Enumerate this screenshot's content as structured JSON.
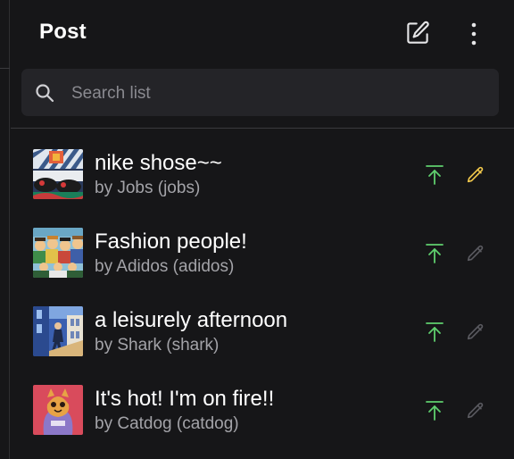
{
  "header": {
    "title": "Post",
    "compose_icon": "compose-icon",
    "more_icon": "more-vertical-icon"
  },
  "search": {
    "placeholder": "Search list",
    "value": "",
    "icon": "search-icon"
  },
  "posts": [
    {
      "title": "nike shose~~",
      "byline": "by Jobs (jobs)",
      "pin_icon": "pin-to-top-icon",
      "edit_icon": "edit-pencil-icon",
      "editable": true
    },
    {
      "title": "Fashion people!",
      "byline": "by Adidos (adidos)",
      "pin_icon": "pin-to-top-icon",
      "edit_icon": "edit-pencil-icon",
      "editable": false
    },
    {
      "title": "a leisurely afternoon",
      "byline": "by Shark (shark)",
      "pin_icon": "pin-to-top-icon",
      "edit_icon": "edit-pencil-icon",
      "editable": false
    },
    {
      "title": "It's hot! I'm on fire!!",
      "byline": "by Catdog (catdog)",
      "pin_icon": "pin-to-top-icon",
      "edit_icon": "edit-pencil-icon",
      "editable": false
    }
  ],
  "colors": {
    "background": "#161618",
    "search_bg": "#242428",
    "pin_green": "#5fcf6e",
    "edit_active": "#f2c94c",
    "edit_inactive": "#5a5a60",
    "subtext": "#a3a3a8"
  }
}
